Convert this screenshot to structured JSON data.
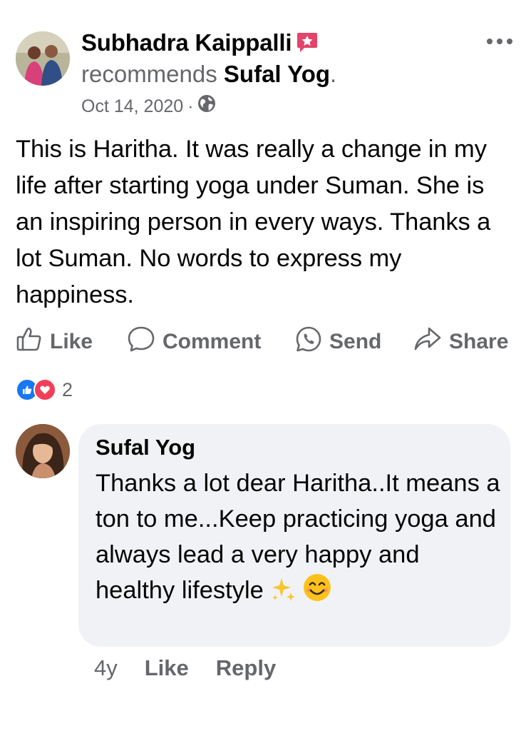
{
  "post": {
    "author": "Subhadra Kaippalli",
    "recommends_word": "recommends",
    "page_name": "Sufal Yog",
    "period": ".",
    "date": "Oct 14, 2020",
    "separator": "·",
    "privacy_icon": "globe-icon",
    "badge_icon": "star-badge-icon",
    "text": "This is Haritha. It was really a change in my life after starting yoga under Suman. She is an inspiring person in every ways. Thanks a lot Suman. No words to express my happiness."
  },
  "actions": {
    "like": "Like",
    "comment": "Comment",
    "send": "Send",
    "share": "Share"
  },
  "reactions": {
    "types": [
      "like",
      "love"
    ],
    "count": "2"
  },
  "comment": {
    "author": "Sufal Yog",
    "text": "Thanks a lot dear Haritha..It means a ton to me...Keep practicing yoga and always lead a very happy and healthy lifestyle",
    "emojis": [
      "sparkles-emoji",
      "smiling-face-emoji"
    ],
    "time": "4y",
    "like": "Like",
    "reply": "Reply"
  },
  "colors": {
    "secondary_text": "#65676b",
    "like_blue": "#1877f2",
    "love_red": "#f33e58",
    "bubble_bg": "#f0f2f5",
    "badge_pink": "#e4436b"
  }
}
